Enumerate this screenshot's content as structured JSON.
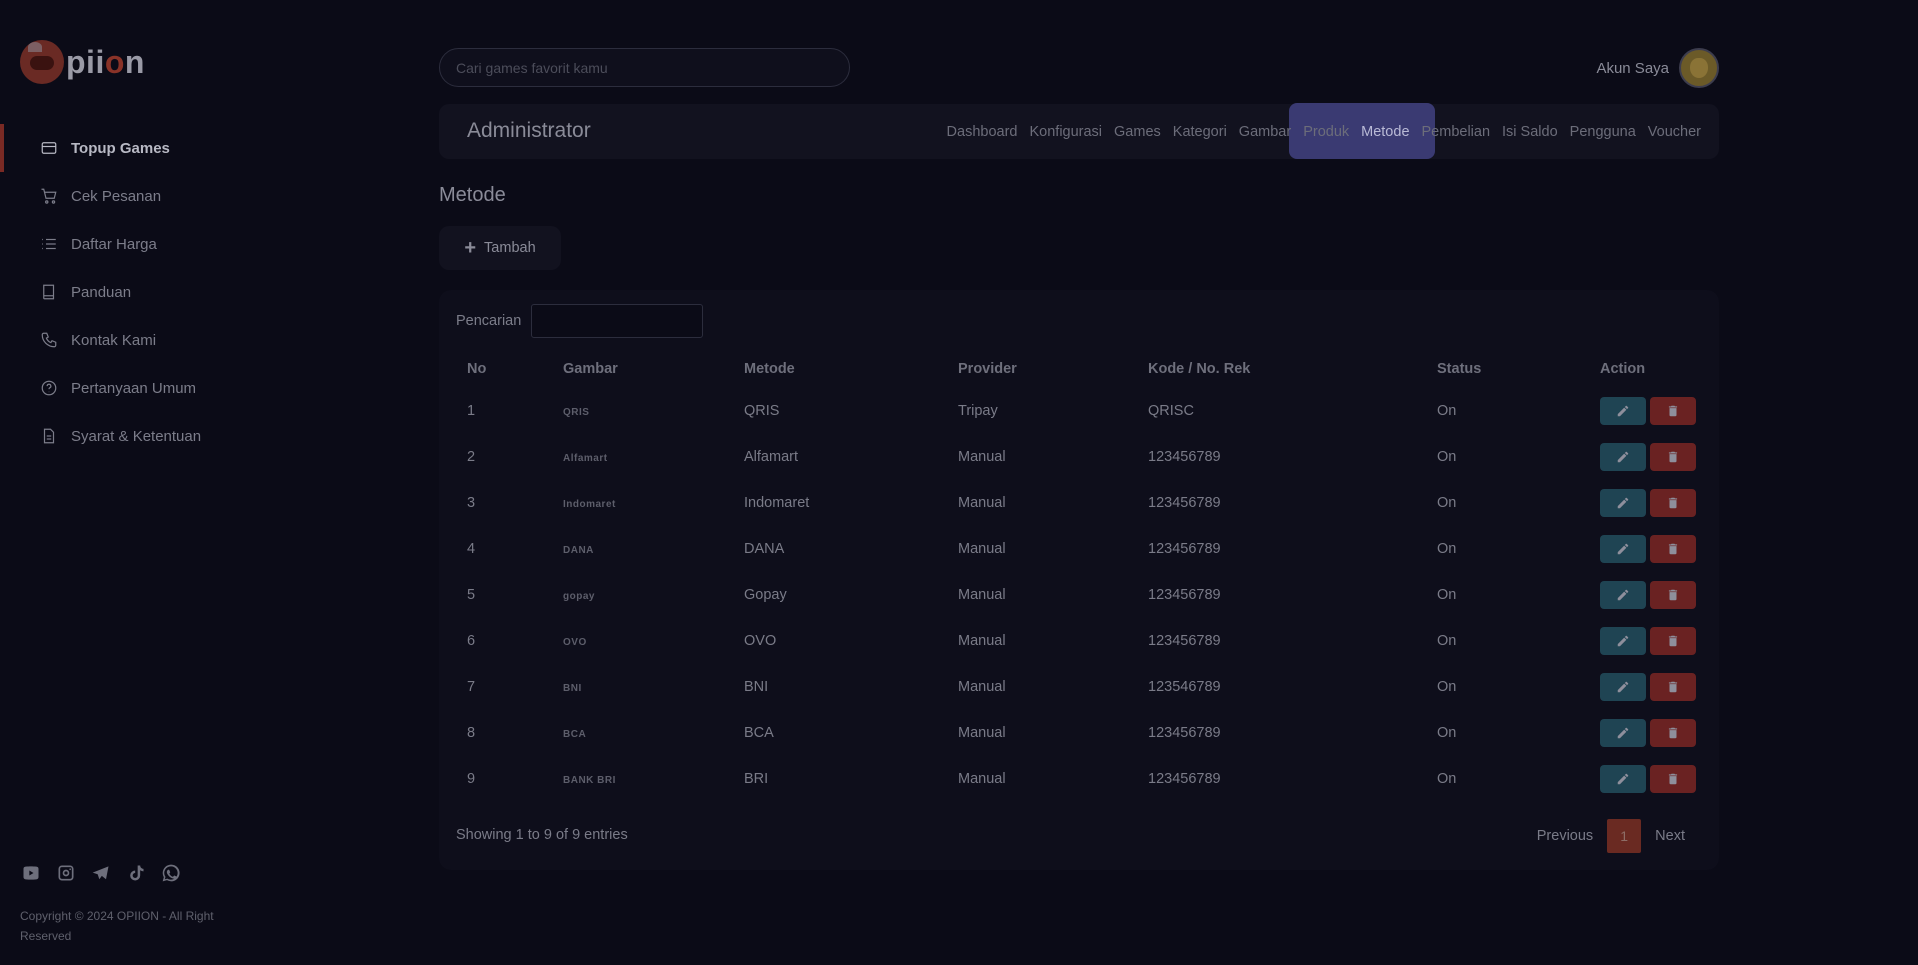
{
  "brand": {
    "name_prefix": "pii",
    "name_o": "o",
    "name_suffix": "n"
  },
  "sidebar": {
    "items": [
      {
        "label": "Topup Games",
        "icon": "card-icon",
        "active": true
      },
      {
        "label": "Cek Pesanan",
        "icon": "cart-icon"
      },
      {
        "label": "Daftar Harga",
        "icon": "list-icon"
      },
      {
        "label": "Panduan",
        "icon": "book-icon"
      },
      {
        "label": "Kontak Kami",
        "icon": "phone-icon"
      },
      {
        "label": "Pertanyaan Umum",
        "icon": "question-icon"
      },
      {
        "label": "Syarat & Ketentuan",
        "icon": "document-icon"
      }
    ],
    "copyright": "Copyright © 2024 OPIION - All Right Reserved"
  },
  "search": {
    "placeholder": "Cari games favorit kamu"
  },
  "account": {
    "label": "Akun Saya"
  },
  "admin": {
    "title": "Administrator",
    "nav": [
      "Dashboard",
      "Konfigurasi",
      "Games",
      "Kategori",
      "Gambar",
      "Produk",
      "Metode",
      "Pembelian",
      "Isi Saldo",
      "Pengguna",
      "Voucher"
    ],
    "active_nav": "Metode"
  },
  "page": {
    "title": "Metode",
    "add_label": "Tambah",
    "filter_label": "Pencarian",
    "columns": [
      "No",
      "Gambar",
      "Metode",
      "Provider",
      "Kode / No. Rek",
      "Status",
      "Action"
    ],
    "rows": [
      {
        "no": "1",
        "logo": "QRIS",
        "metode": "QRIS",
        "provider": "Tripay",
        "kode": "QRISC",
        "status": "On"
      },
      {
        "no": "2",
        "logo": "Alfamart",
        "metode": "Alfamart",
        "provider": "Manual",
        "kode": "123456789",
        "status": "On"
      },
      {
        "no": "3",
        "logo": "Indomaret",
        "metode": "Indomaret",
        "provider": "Manual",
        "kode": "123456789",
        "status": "On"
      },
      {
        "no": "4",
        "logo": "DANA",
        "metode": "DANA",
        "provider": "Manual",
        "kode": "123456789",
        "status": "On"
      },
      {
        "no": "5",
        "logo": "gopay",
        "metode": "Gopay",
        "provider": "Manual",
        "kode": "123456789",
        "status": "On"
      },
      {
        "no": "6",
        "logo": "OVO",
        "metode": "OVO",
        "provider": "Manual",
        "kode": "123456789",
        "status": "On"
      },
      {
        "no": "7",
        "logo": "BNI",
        "metode": "BNI",
        "provider": "Manual",
        "kode": "123546789",
        "status": "On"
      },
      {
        "no": "8",
        "logo": "BCA",
        "metode": "BCA",
        "provider": "Manual",
        "kode": "123456789",
        "status": "On"
      },
      {
        "no": "9",
        "logo": "BANK BRI",
        "metode": "BRI",
        "provider": "Manual",
        "kode": "123456789",
        "status": "On"
      }
    ],
    "showing": "Showing 1 to 9 of 9 entries",
    "pager": {
      "previous": "Previous",
      "current": "1",
      "next": "Next"
    }
  },
  "colors": {
    "accent": "#7a2a24",
    "nav_highlight": "#3a3a72",
    "edit": "#1f4453",
    "delete": "#6a2222"
  }
}
